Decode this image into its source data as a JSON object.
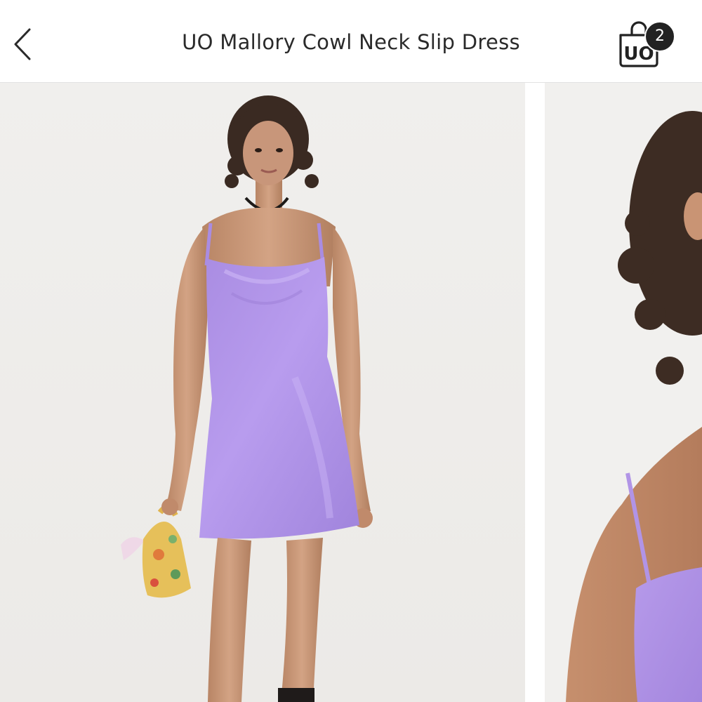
{
  "nav": {
    "back_icon": "chevron-left-icon",
    "title": "UO Mallory Cowl Neck Slip Dress",
    "cart_icon": "uo-bag-icon",
    "cart_count": "2",
    "cart_logo_text": "UO"
  },
  "gallery": {
    "images": [
      {
        "subject": "full-length",
        "background": "#efeeec",
        "accent": "#b596e8"
      },
      {
        "subject": "shoulder-closeup",
        "background": "#f1f0ee",
        "accent": "#b99ae8"
      }
    ]
  },
  "colors": {
    "nav_background": "#ffffff",
    "title_text": "#2a2a2a",
    "badge_background": "#222222",
    "dress_lavender": "#b596e8"
  }
}
